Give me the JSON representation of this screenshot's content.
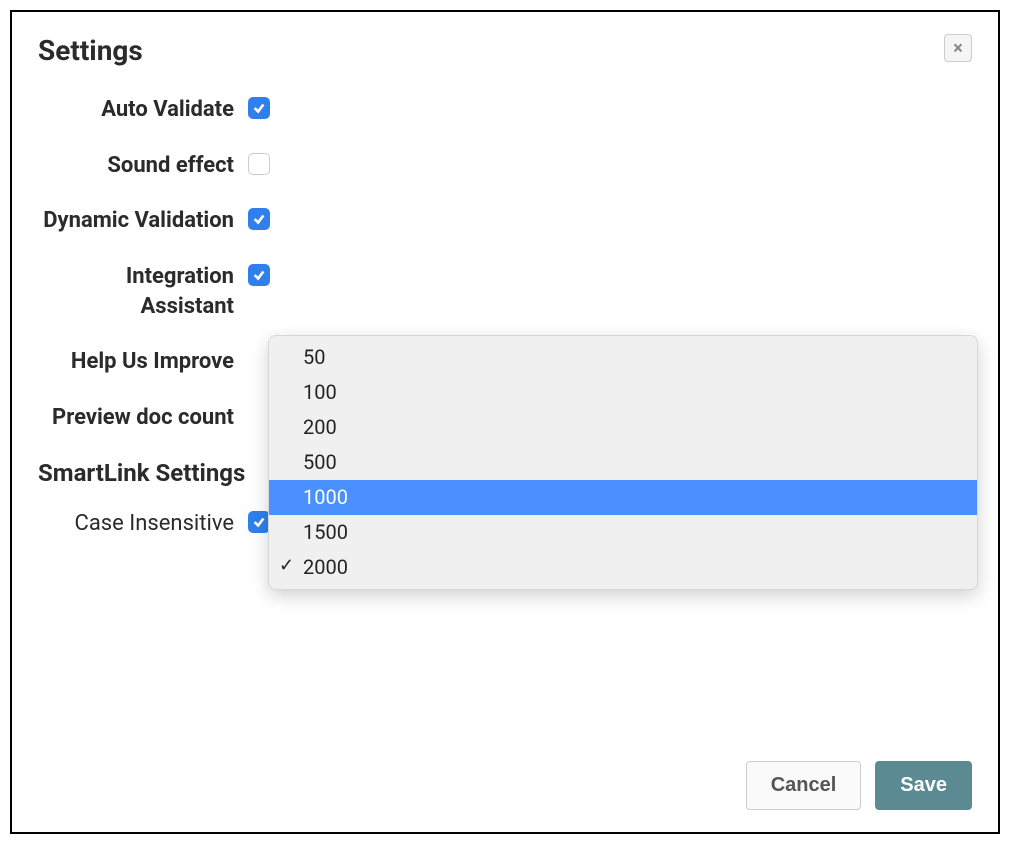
{
  "modal": {
    "title": "Settings",
    "close_icon": "×"
  },
  "fields": {
    "auto_validate": {
      "label": "Auto Validate",
      "checked": true
    },
    "sound_effect": {
      "label": "Sound effect",
      "checked": false
    },
    "dynamic_validation": {
      "label": "Dynamic Validation",
      "checked": true
    },
    "integration_assistant": {
      "label": "Integration Assistant",
      "checked": true
    },
    "help_us_improve": {
      "label": "Help Us Improve"
    },
    "preview_doc_count": {
      "label": "Preview doc count"
    }
  },
  "dropdown": {
    "options": [
      "50",
      "100",
      "200",
      "500",
      "1000",
      "1500",
      "2000"
    ],
    "highlighted": "1000",
    "selected": "2000"
  },
  "smartlink": {
    "section_title": "SmartLink Settings",
    "case_insensitive": {
      "label": "Case Insensitive",
      "checked": true
    }
  },
  "footer": {
    "cancel": "Cancel",
    "save": "Save"
  }
}
